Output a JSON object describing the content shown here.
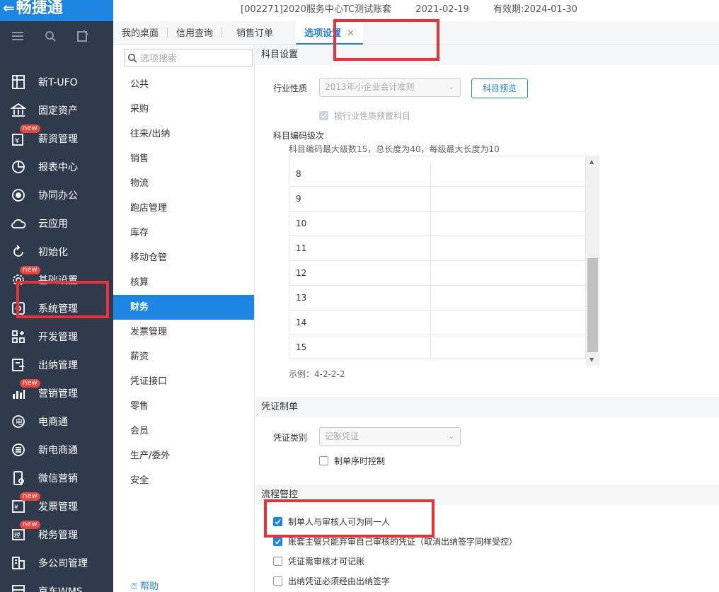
{
  "app": {
    "logo_text": "畅捷通",
    "account_info": "[002271]2020服务中心TC测试账套",
    "date": "2021-02-19",
    "expiry": "有效期:2024-01-30"
  },
  "sidebar": {
    "items": [
      {
        "label": "新T-UFO",
        "icon": "ufo-icon",
        "new": false
      },
      {
        "label": "固定资产",
        "icon": "bank-icon",
        "new": false
      },
      {
        "label": "薪资管理",
        "icon": "salary-icon",
        "new": true
      },
      {
        "label": "报表中心",
        "icon": "pie-chart-icon",
        "new": false
      },
      {
        "label": "协同办公",
        "icon": "target-icon",
        "new": false
      },
      {
        "label": "云应用",
        "icon": "cloud-icon",
        "new": false
      },
      {
        "label": "初始化",
        "icon": "refresh-icon",
        "new": false
      },
      {
        "label": "基础设置",
        "icon": "settings-icon",
        "new": true
      },
      {
        "label": "系统管理",
        "icon": "system-icon",
        "new": false
      },
      {
        "label": "开发管理",
        "icon": "grid-plus-icon",
        "new": false
      },
      {
        "label": "出纳管理",
        "icon": "cashier-icon",
        "new": false
      },
      {
        "label": "营销管理",
        "icon": "marketing-icon",
        "new": true
      },
      {
        "label": "电商通",
        "icon": "ecommerce-icon",
        "new": false
      },
      {
        "label": "新电商通",
        "icon": "new-ecommerce-icon",
        "new": false
      },
      {
        "label": "微信营销",
        "icon": "wechat-icon",
        "new": false
      },
      {
        "label": "发票管理",
        "icon": "invoice-icon",
        "new": true
      },
      {
        "label": "税务管理",
        "icon": "tax-icon",
        "new": true
      },
      {
        "label": "多公司管理",
        "icon": "building-icon",
        "new": false
      },
      {
        "label": "京东WMS",
        "icon": "warehouse-icon",
        "new": false
      }
    ],
    "new_badge": "new"
  },
  "tabs": [
    {
      "label": "我的桌面"
    },
    {
      "label": "信用查询"
    },
    {
      "label": "销售订单"
    },
    {
      "label": "选项设置",
      "active": true,
      "close": "✕"
    }
  ],
  "options": {
    "search_placeholder": "选项搜索",
    "items": [
      "公共",
      "采购",
      "往来/出纳",
      "销售",
      "物流",
      "跑店管理",
      "库存",
      "移动仓管",
      "核算",
      "财务",
      "发票管理",
      "薪资",
      "凭证接口",
      "零售",
      "会员",
      "生产/委外",
      "安全"
    ],
    "active_index": 9,
    "help": "帮助"
  },
  "main": {
    "subject_section": "科目设置",
    "industry_label": "行业性质",
    "industry_value": "2013年小企业会计准则",
    "preview_button": "科目预览",
    "preset_checkbox": "按行业性质预置科目",
    "code_level_title": "科目编码级次",
    "code_level_hint": "科目编码最大级数15，总长度为40，每级最大长度为10",
    "levels": [
      "8",
      "9",
      "10",
      "11",
      "12",
      "13",
      "14",
      "15"
    ],
    "example": "示例：4-2-2-2",
    "voucher_section": "凭证制单",
    "voucher_type_label": "凭证类别",
    "voucher_type_value": "记账凭证",
    "order_control": "制单序时控制",
    "process_section": "流程管控",
    "process_items": [
      {
        "label": "制单人与审核人可为同一人",
        "checked": true
      },
      {
        "label": "账套主管只能弃审自己审核的凭证（取消出纳签字同样受控）",
        "checked": true
      },
      {
        "label": "凭证需审核才可记账",
        "checked": false
      },
      {
        "label": "出纳凭证必须经由出纳签字",
        "checked": false
      }
    ]
  },
  "colors": {
    "accent": "#1d85e2",
    "sidebar_bg": "#2f3b4c",
    "highlight": "#e8323a",
    "badge": "#e8453c"
  }
}
